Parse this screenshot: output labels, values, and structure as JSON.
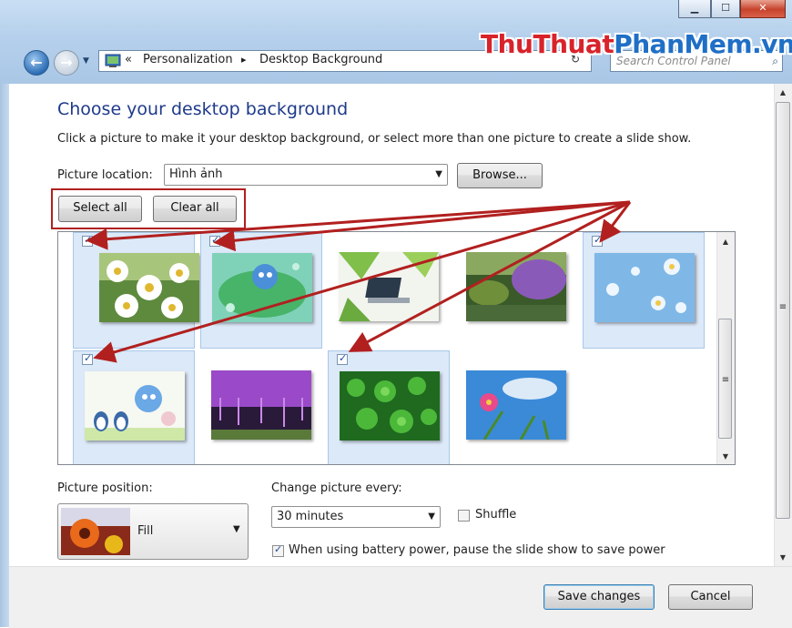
{
  "window": {
    "minimize_glyph": "▁",
    "maximize_glyph": "☐",
    "close_glyph": "✕",
    "back_icon": "back-arrow-icon",
    "forward_icon": "forward-arrow-icon",
    "watermark_parts": [
      "Thu",
      "Thuat",
      "PhanMem",
      ".vn"
    ],
    "watermark_colors": [
      "#d8232a",
      "#d8232a",
      "#1f6fc6",
      "#1f6fc6"
    ],
    "search_placeholder": "Search Control Panel"
  },
  "breadcrumb": {
    "overflow": "«",
    "items": [
      "Personalization",
      "Desktop Background"
    ],
    "separator": "▸"
  },
  "page": {
    "title": "Choose your desktop background",
    "description": "Click a picture to make it your desktop background, or select more than one picture to create a slide show."
  },
  "location": {
    "label": "Picture location:",
    "value": "Hình ảnh",
    "browse_label": "Browse..."
  },
  "selection": {
    "select_all_label": "Select all",
    "clear_all_label": "Clear all"
  },
  "gallery": {
    "items": [
      {
        "name": "daisies",
        "checked": true
      },
      {
        "name": "cartoon-bear-leaf",
        "checked": true
      },
      {
        "name": "laptop-green-leaves",
        "checked": false
      },
      {
        "name": "garden-wisteria",
        "checked": false
      },
      {
        "name": "blue-flowers",
        "checked": true
      },
      {
        "name": "cartoon-bears-penguins",
        "checked": true
      },
      {
        "name": "purple-wisteria",
        "checked": false
      },
      {
        "name": "green-clover",
        "checked": true
      },
      {
        "name": "pink-flower-sky",
        "checked": false
      }
    ]
  },
  "position": {
    "label": "Picture position:",
    "value": "Fill"
  },
  "slideshow": {
    "interval_label": "Change picture every:",
    "interval_value": "30 minutes",
    "shuffle_label": "Shuffle",
    "shuffle_checked": false,
    "battery_label": "When using battery power, pause the slide show to save power",
    "battery_checked": true
  },
  "footer": {
    "save_label": "Save changes",
    "cancel_label": "Cancel"
  },
  "colors": {
    "annotation_red": "#b1201f",
    "title_blue": "#1e3a8a"
  }
}
